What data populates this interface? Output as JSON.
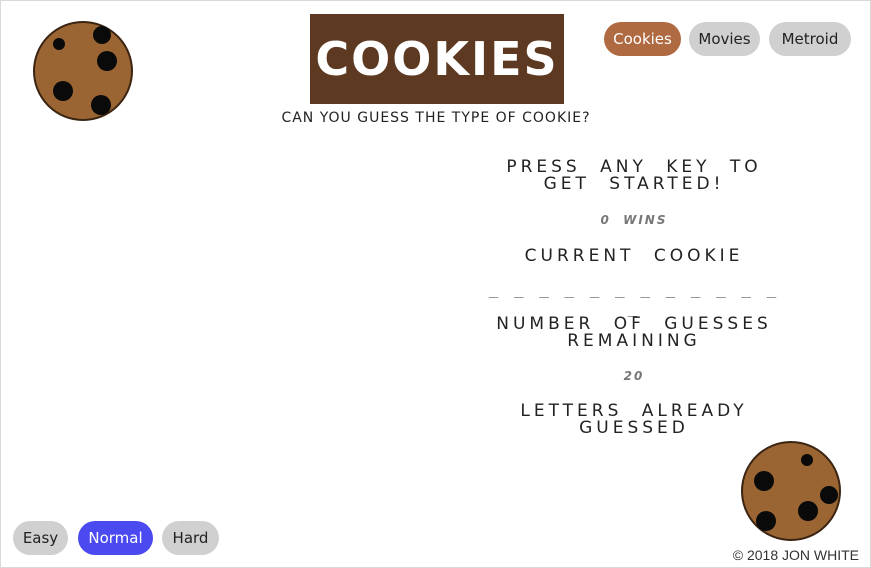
{
  "header": {
    "title": "COOKIES",
    "subtitle": "CAN YOU GUESS THE TYPE OF COOKIE?"
  },
  "nav": {
    "items": [
      {
        "label": "Cookies",
        "active": true
      },
      {
        "label": "Movies",
        "active": false
      },
      {
        "label": "Metroid",
        "active": false
      }
    ]
  },
  "game": {
    "prompt": "PRESS ANY KEY TO GET STARTED!",
    "wins_count": "0",
    "wins_label": "WINS",
    "current_label": "CURRENT COOKIE",
    "current_word": "_ _ _ _ _ _ _ _ _   _ _ _ _",
    "guesses_label": "NUMBER OF GUESSES REMAINING",
    "guesses_value": "20",
    "letters_label": "LETTERS ALREADY GUESSED"
  },
  "difficulty": {
    "options": [
      {
        "label": "Easy",
        "active": false
      },
      {
        "label": "Normal",
        "active": true
      },
      {
        "label": "Hard",
        "active": false
      }
    ]
  },
  "footer": {
    "copyright": "© 2018 JON WHITE"
  },
  "colors": {
    "title_bg": "#5c3920",
    "nav_active": "#b06a42",
    "difficulty_active": "#4a4af0",
    "pill_inactive": "#d0d0d0",
    "cookie": "#9a6532"
  },
  "icons": {
    "top_left": "cookie-icon",
    "bottom_right": "cookie-icon"
  }
}
